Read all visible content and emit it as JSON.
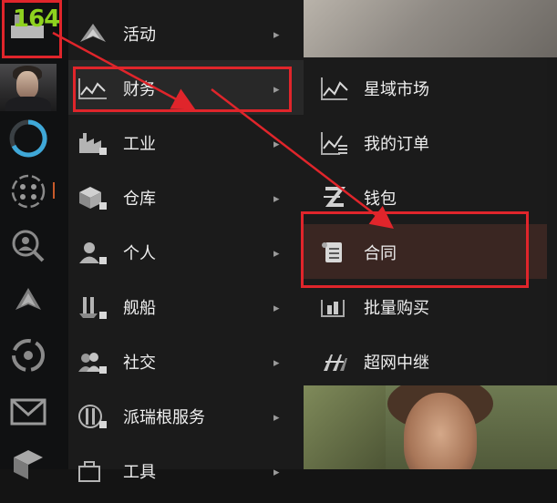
{
  "sidebar": {
    "counter": "164",
    "items": [
      {
        "icon": "agency-icon"
      },
      {
        "icon": "character-portrait"
      },
      {
        "icon": "progress-ring-icon"
      },
      {
        "icon": "neocom-hub-icon"
      },
      {
        "icon": "search-people-icon"
      },
      {
        "icon": "ship-icon"
      },
      {
        "icon": "target-circle-icon"
      },
      {
        "icon": "mail-icon"
      },
      {
        "icon": "cube-icon"
      }
    ]
  },
  "menu": {
    "items": [
      {
        "label": "活动",
        "icon": "activities-icon",
        "arrow": "▸"
      },
      {
        "label": "财务",
        "icon": "finance-chart-icon",
        "arrow": "▸"
      },
      {
        "label": "工业",
        "icon": "industry-factory-icon",
        "arrow": "▸"
      },
      {
        "label": "仓库",
        "icon": "inventory-cube-icon",
        "arrow": "▸"
      },
      {
        "label": "个人",
        "icon": "person-icon",
        "arrow": "▸"
      },
      {
        "label": "舰船",
        "icon": "ship-fitting-icon",
        "arrow": "▸"
      },
      {
        "label": "社交",
        "icon": "social-people-icon",
        "arrow": "▸"
      },
      {
        "label": "派瑞根服务",
        "icon": "pyrgen-services-icon",
        "arrow": "▸"
      },
      {
        "label": "工具",
        "icon": "tools-icon",
        "arrow": "▸"
      }
    ]
  },
  "submenu": {
    "items": [
      {
        "label": "星域市场",
        "icon": "market-chart-icon"
      },
      {
        "label": "我的订单",
        "icon": "my-orders-icon"
      },
      {
        "label": "钱包",
        "icon": "wallet-icon"
      },
      {
        "label": "合同",
        "icon": "contract-scroll-icon"
      },
      {
        "label": "批量购买",
        "icon": "bulk-buy-icon"
      },
      {
        "label": "超网中继",
        "icon": "hypernet-relay-icon"
      }
    ]
  },
  "colors": {
    "highlight_red": "#e0252b",
    "counter_green": "#8ed21f",
    "menu_bg": "#1b1b1b",
    "selected_sub_bg": "#3a2622"
  }
}
